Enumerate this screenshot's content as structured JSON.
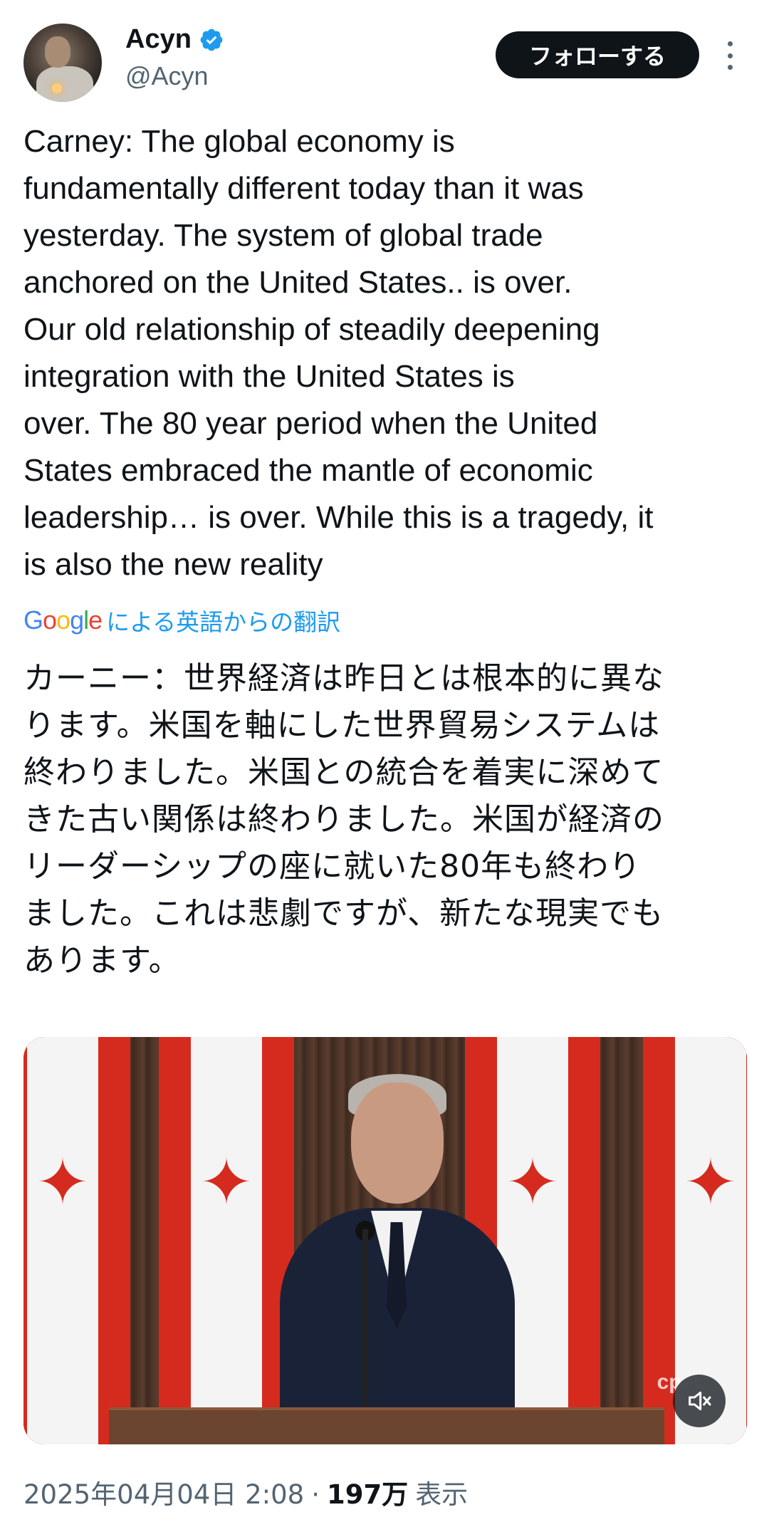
{
  "author": {
    "display_name": "Acyn",
    "handle": "@Acyn",
    "verified": true
  },
  "actions": {
    "follow_label": "フォローする"
  },
  "tweet": {
    "text": "Carney: The global economy is\nfundamentally different today than it was\nyesterday. The system of global trade\nanchored on the United States.. is over.\nOur old relationship of steadily deepening\nintegration with the United States is\nover. The 80 year period when the United\nStates embraced the mantle of economic\nleadership… is over. While this is a tragedy, it\nis also the new reality",
    "translation_provider": "Google",
    "translation_label": "による英語からの翻訳",
    "translated_text": "カーニー：世界経済は昨日とは根本的に異な\nります。米国を軸にした世界貿易システムは\n終わりました。米国との統合を着実に深めて\nきた古い関係は終わりました。米国が経済の\nリーダーシップの座に就いた80年も終わり\nました。これは悲劇ですが、新たな現実でも\nあります。"
  },
  "media": {
    "watermark": "cpac",
    "mute_icon": "speaker-muted-icon"
  },
  "meta": {
    "timestamp": "2025年04月04日 2:08",
    "separator": "·",
    "views_count": "197万",
    "views_label": "表示"
  },
  "colors": {
    "primary_text": "#0f1419",
    "secondary_text": "#536471",
    "link_blue": "#1d9bf0",
    "verified_blue": "#1d9bf0",
    "flag_red": "#d52b1e"
  }
}
